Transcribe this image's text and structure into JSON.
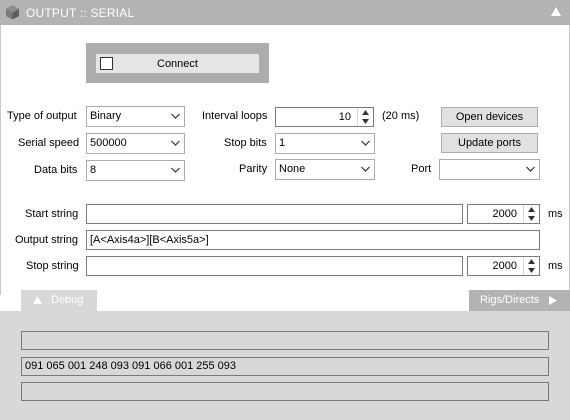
{
  "window": {
    "title": "OUTPUT :: SERIAL"
  },
  "connect": {
    "label": "Connect",
    "checked": false
  },
  "settings": {
    "type_of_output": {
      "label": "Type of output",
      "value": "Binary"
    },
    "serial_speed": {
      "label": "Serial speed",
      "value": "500000"
    },
    "data_bits": {
      "label": "Data bits",
      "value": "8"
    },
    "interval_loops": {
      "label": "Interval loops",
      "value": "10",
      "unit": "(20 ms)"
    },
    "stop_bits": {
      "label": "Stop bits",
      "value": "1"
    },
    "parity": {
      "label": "Parity",
      "value": "None"
    },
    "port": {
      "label": "Port",
      "value": ""
    }
  },
  "buttons": {
    "open_devices": "Open devices",
    "update_ports": "Update ports"
  },
  "strings": {
    "start": {
      "label": "Start string",
      "value": "",
      "delay": "2000",
      "unit": "ms"
    },
    "output": {
      "label": "Output string",
      "value": "[A<Axis4a>][B<Axis5a>]"
    },
    "stop": {
      "label": "Stop string",
      "value": "",
      "delay": "2000",
      "unit": "ms"
    }
  },
  "tabs": {
    "debug": "Debug",
    "rigs": "Rigs/Directs"
  },
  "debug": {
    "line1": "",
    "line2": "091 065 001 248 093 091 066 001 255 093",
    "line3": ""
  },
  "colors": {
    "title_bar": "#b3b3b3",
    "panel_bg": "#d8d8d8",
    "title_text": "#ffffff"
  }
}
